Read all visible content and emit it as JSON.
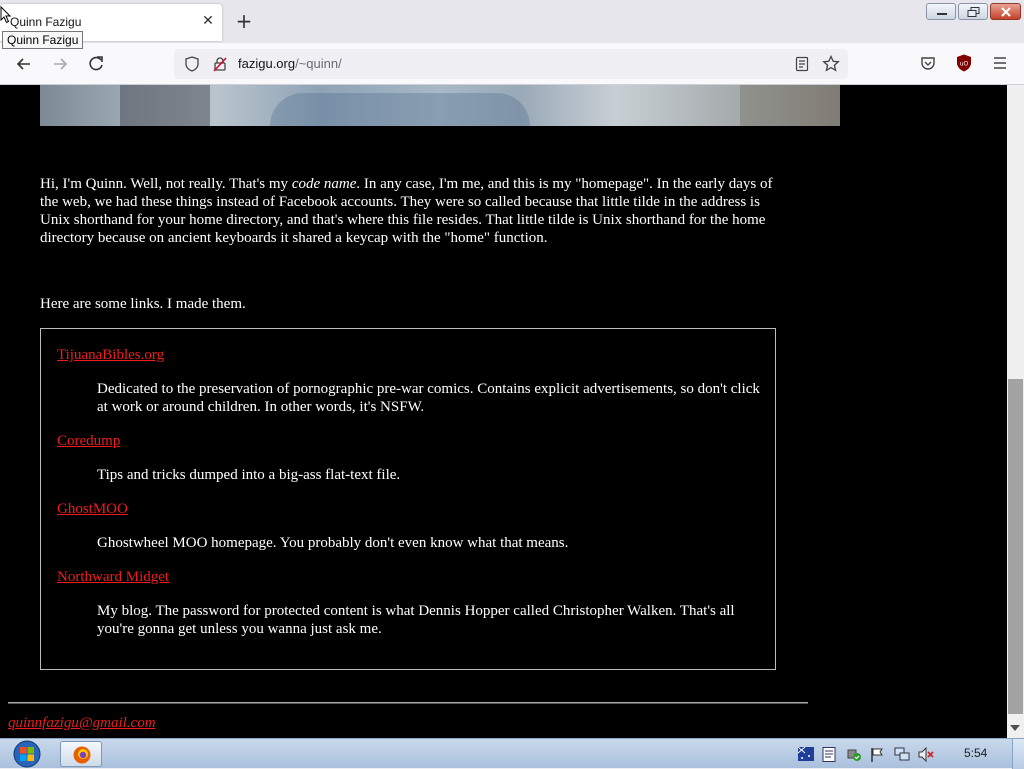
{
  "browser": {
    "tab_title": "Quinn Fazigu",
    "tooltip": "Quinn Fazigu",
    "url_domain": "fazigu.org",
    "url_path": "/~quinn/"
  },
  "page": {
    "intro_before": "Hi, I'm Quinn. Well, not really. That's my ",
    "intro_italic": "code name",
    "intro_after": ". In any case, I'm me, and this is my \"homepage\". In the early days of the web, we had these things instead of Facebook accounts. They were so called because that little tilde in the address is Unix shorthand for your home directory, and that's where this file resides. That little tilde is Unix shorthand for the home directory because on ancient keyboards it shared a keycap with the \"home\" function.",
    "links_intro": "Here are some links. I made them.",
    "links": [
      {
        "title": "TijuanaBibles.org",
        "desc": "Dedicated to the preservation of pornographic pre-war comics. Contains explicit advertisements, so don't click at work or around children. In other words, it's NSFW."
      },
      {
        "title": "Coredump",
        "desc": "Tips and tricks dumped into a big-ass flat-text file."
      },
      {
        "title": "GhostMOO",
        "desc": "Ghostwheel MOO homepage. You probably don't even know what that means."
      },
      {
        "title": "Northward Midget",
        "desc": "My blog. The password for protected content is what Dennis Hopper called Christopher Walken. That's all you're gonna get unless you wanna just ask me."
      }
    ],
    "email": "quinnfazigu@gmail.com",
    "link_color": "#ee1c1c"
  },
  "taskbar": {
    "clock": "5:54"
  }
}
